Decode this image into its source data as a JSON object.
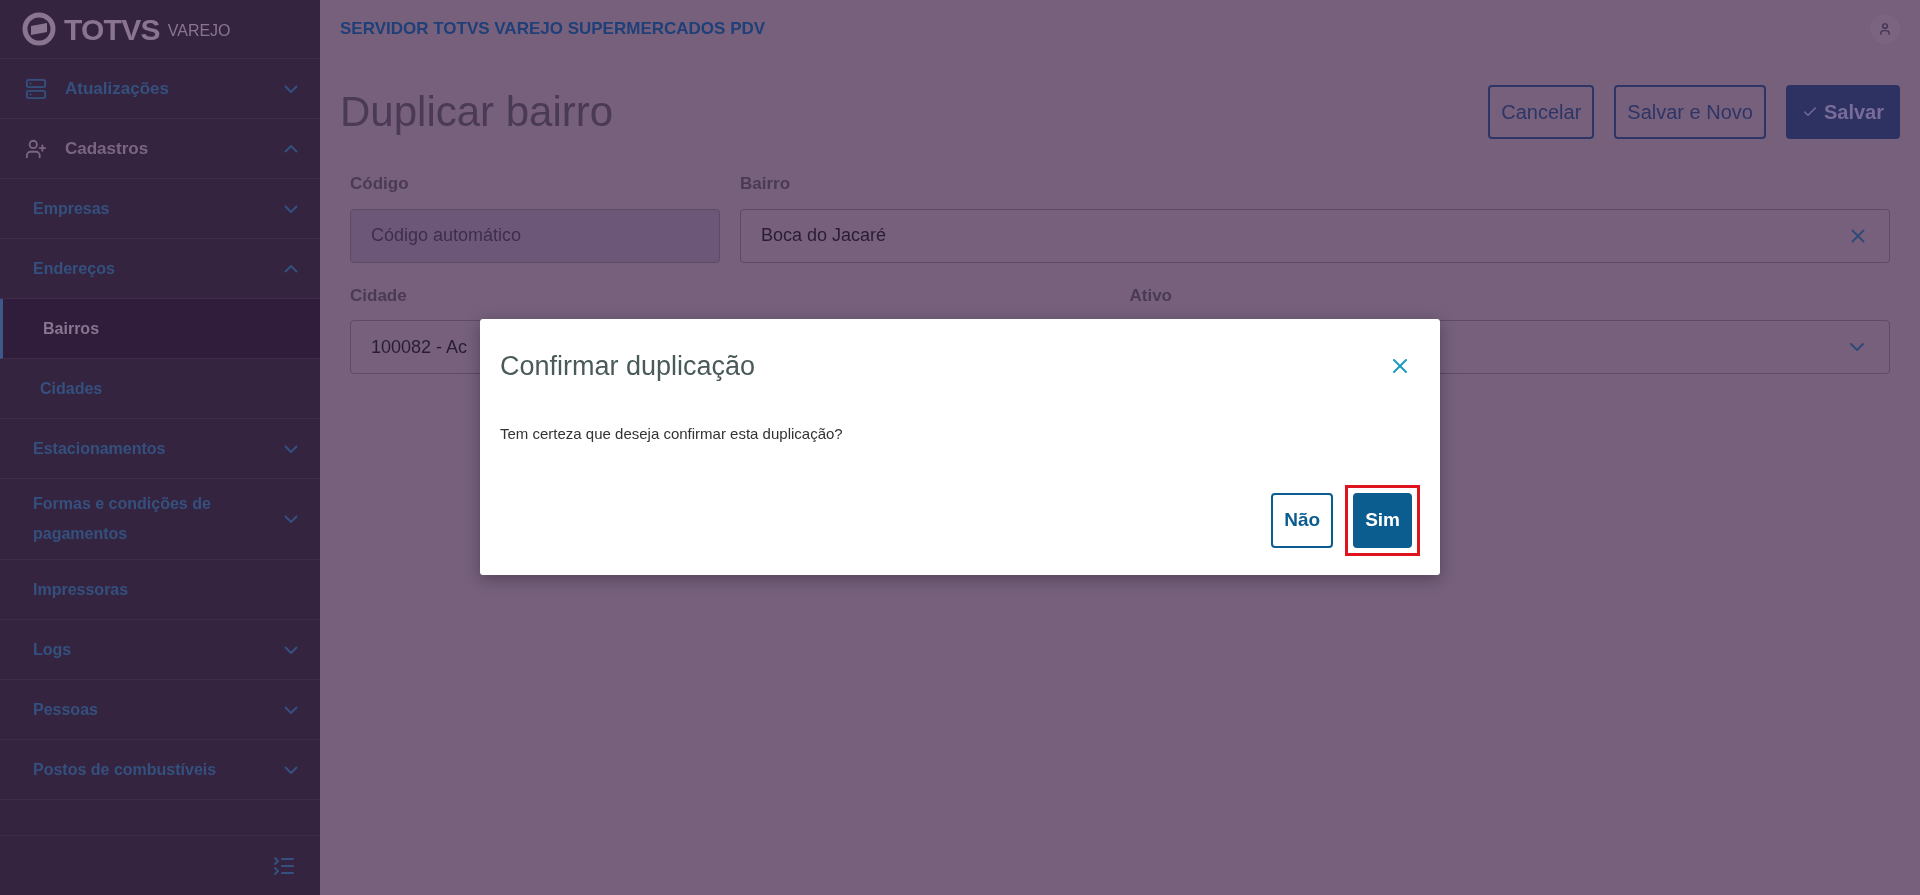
{
  "sidebar": {
    "logo": {
      "brand": "TOTVS",
      "product": "VAREJO"
    },
    "items": [
      {
        "label": "Atualizações",
        "expanded": false,
        "selected": false
      },
      {
        "label": "Cadastros",
        "expanded": true,
        "selected": false,
        "children": [
          {
            "label": "Empresas",
            "expanded": false,
            "selected": false
          },
          {
            "label": "Endereços",
            "expanded": true,
            "selected": false,
            "children": [
              {
                "label": "Bairros",
                "selected": true
              },
              {
                "label": "Cidades",
                "selected": false
              }
            ]
          },
          {
            "label": "Estacionamentos",
            "expanded": false,
            "selected": false
          },
          {
            "label": "Formas e condições de pagamentos",
            "expanded": false,
            "selected": false
          },
          {
            "label": "Impressoras",
            "selected": false
          },
          {
            "label": "Logs",
            "expanded": false,
            "selected": false
          },
          {
            "label": "Pessoas",
            "expanded": false,
            "selected": false
          },
          {
            "label": "Postos de combustíveis",
            "expanded": false,
            "selected": false
          }
        ]
      }
    ]
  },
  "header": {
    "title": "SERVIDOR TOTVS VAREJO SUPERMERCADOS PDV"
  },
  "page": {
    "title": "Duplicar bairro",
    "actions": [
      {
        "label": "Cancelar",
        "kind": "outline"
      },
      {
        "label": "Salvar e Novo",
        "kind": "outline"
      },
      {
        "label": "Salvar",
        "kind": "primary"
      }
    ],
    "fields": [
      {
        "label": "Código",
        "kind": "input",
        "placeholder": "Código automático",
        "disabled": true
      },
      {
        "label": "Bairro",
        "kind": "input",
        "value": "Boca do Jacaré",
        "clearable": true
      },
      {
        "label": "Cidade",
        "kind": "input",
        "value": "100082 - Ac"
      },
      {
        "label": "Ativo",
        "kind": "select"
      }
    ]
  },
  "dialog": {
    "title": "Confirmar duplicação",
    "message": "Tem certeza que deseja confirmar esta duplicação?",
    "buttons": [
      {
        "label": "Não",
        "kind": "secondary",
        "highlighted": false
      },
      {
        "label": "Sim",
        "kind": "primary",
        "highlighted": true
      }
    ]
  }
}
